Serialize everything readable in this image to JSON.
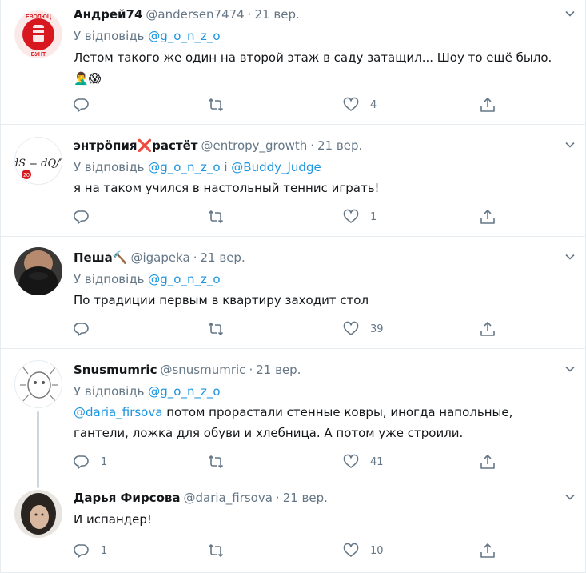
{
  "tweets": [
    {
      "name": "Андрей74",
      "handle": "@andersen7474",
      "dot": "·",
      "date": "21 вер.",
      "reply_prefix": "У відповідь",
      "reply_user": "@g_o_n_z_o",
      "text": "Летом такого же один на второй этаж в саду затащил... Шоу то ещё было. 🤦‍♂️😱",
      "reply_count": "",
      "retweet_count": "",
      "like_count": "4"
    },
    {
      "name": "энтрӧпия❌растёт",
      "handle": "@entropy_growth",
      "dot": "·",
      "date": "21 вер.",
      "reply_prefix": "У відповідь",
      "reply_user": "@g_o_n_z_o",
      "reply_and": "і",
      "reply_user2": "@Buddy_Judge",
      "text": "я на таком учился в настольный теннис играть!",
      "reply_count": "",
      "retweet_count": "",
      "like_count": "1"
    },
    {
      "name": "Пеша🔨",
      "handle": "@igapeka",
      "dot": "·",
      "date": "21 вер.",
      "reply_prefix": "У відповідь",
      "reply_user": "@g_o_n_z_o",
      "text": "По традиции первым в квартиру заходит стол",
      "reply_count": "",
      "retweet_count": "",
      "like_count": "39"
    },
    {
      "name": "Snusmumric",
      "handle": "@snusmumric",
      "dot": "·",
      "date": "21 вер.",
      "reply_prefix": "У відповідь",
      "reply_user": "@g_o_n_z_o",
      "mention": "@daria_firsova",
      "text_line1": "потом прорастали стенные ковры, иногда напольные,",
      "text_line2": "гантели, ложка для обуви и хлебница. А потом уже строили.",
      "reply_count": "1",
      "retweet_count": "",
      "like_count": "41"
    },
    {
      "name": "Дарья Фирсова",
      "handle": "@daria_firsova",
      "dot": "·",
      "date": "21 вер.",
      "text": "И испандер!",
      "reply_count": "1",
      "retweet_count": "",
      "like_count": "10"
    }
  ],
  "colors": {
    "accent": "#1b95e0",
    "muted": "#657786",
    "separator": "#e6ecf0",
    "thread_line": "#ccd6dd"
  },
  "icons": {
    "reply": "reply-icon",
    "retweet": "retweet-icon",
    "like": "like-icon",
    "share": "share-icon",
    "caret": "chevron-down-icon"
  },
  "avatar_texts": {
    "a0_top": "ЕВОЛЮЦ",
    "a0_bottom": "БУНТ",
    "a1_formula": "dS = dQ/T",
    "a1_badge": "20"
  }
}
